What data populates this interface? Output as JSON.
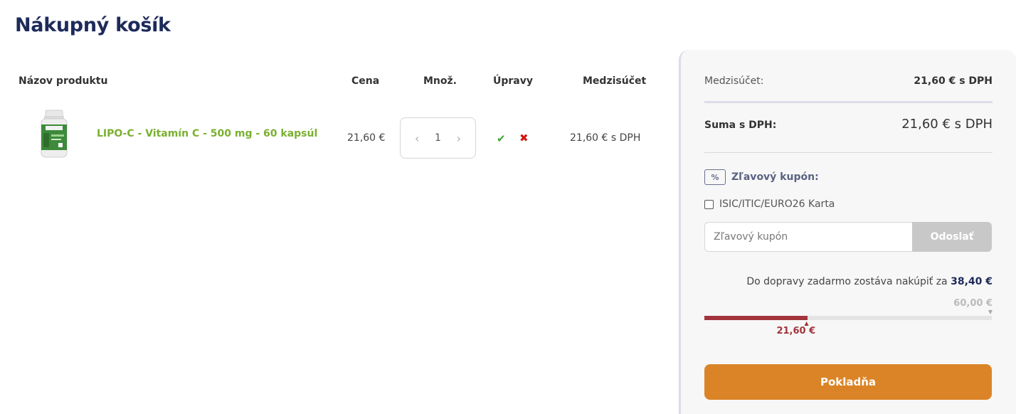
{
  "page": {
    "title": "Nákupný košík"
  },
  "cart": {
    "columns": {
      "name": "Názov produktu",
      "price": "Cena",
      "quantity": "Množ.",
      "edit": "Úpravy",
      "subtotal": "Medzisúčet"
    },
    "items": [
      {
        "name": "LIPO-C - Vitamín C - 500 mg - 60 kapsúl",
        "price": "21,60 €",
        "quantity": "1",
        "subtotal": "21,60 € s DPH",
        "image": "product-bottle-icon"
      }
    ]
  },
  "summary": {
    "subtotal_label": "Medzisúčet:",
    "subtotal_value": "21,60 € s DPH",
    "total_label": "Suma s DPH:",
    "total_value": "21,60 € s DPH",
    "coupon_title": "Zľavový kupón:",
    "coupon_icon_glyph": "%",
    "isic_label": "ISIC/ITIC/EURO26 Karta",
    "coupon_placeholder": "Zľavový kupón",
    "coupon_submit": "Odoslať",
    "shipping_text": "Do dopravy zadarmo zostáva nakúpiť za",
    "shipping_remaining": "38,40 €",
    "progress": {
      "current": 21.6,
      "max": 60,
      "current_label": "21,60 €",
      "max_label": "60,00 €"
    },
    "checkout_label": "Pokladňa"
  },
  "colors": {
    "title": "#1e2a5a",
    "product_link": "#7ab030",
    "confirm": "#3fa535",
    "remove": "#d01818",
    "progress_fill": "#a3343c",
    "checkout": "#db8427"
  }
}
